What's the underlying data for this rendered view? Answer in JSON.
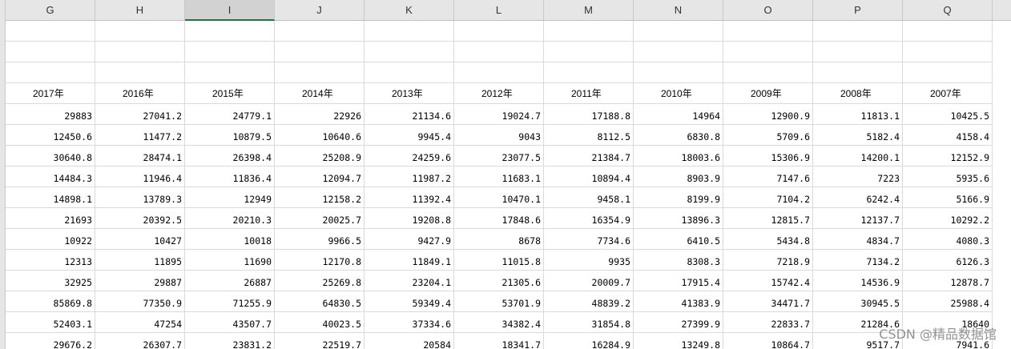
{
  "columns": [
    "G",
    "H",
    "I",
    "J",
    "K",
    "L",
    "M",
    "N",
    "O",
    "P",
    "Q"
  ],
  "active_column": "I",
  "year_headers": [
    "2017年",
    "2016年",
    "2015年",
    "2014年",
    "2013年",
    "2012年",
    "2011年",
    "2010年",
    "2009年",
    "2008年",
    "2007年"
  ],
  "rows": [
    [
      "29883",
      "27041.2",
      "24779.1",
      "22926",
      "21134.6",
      "19024.7",
      "17188.8",
      "14964",
      "12900.9",
      "11813.1",
      "10425.5"
    ],
    [
      "12450.6",
      "11477.2",
      "10879.5",
      "10640.6",
      "9945.4",
      "9043",
      "8112.5",
      "6830.8",
      "5709.6",
      "5182.4",
      "4158.4"
    ],
    [
      "30640.8",
      "28474.1",
      "26398.4",
      "25208.9",
      "24259.6",
      "23077.5",
      "21384.7",
      "18003.6",
      "15306.9",
      "14200.1",
      "12152.9"
    ],
    [
      "14484.3",
      "11946.4",
      "11836.4",
      "12094.7",
      "11987.2",
      "11683.1",
      "10894.4",
      "8903.9",
      "7147.6",
      "7223",
      "5935.6"
    ],
    [
      "14898.1",
      "13789.3",
      "12949",
      "12158.2",
      "11392.4",
      "10470.1",
      "9458.1",
      "8199.9",
      "7104.2",
      "6242.4",
      "5166.9"
    ],
    [
      "21693",
      "20392.5",
      "20210.3",
      "20025.7",
      "19208.8",
      "17848.6",
      "16354.9",
      "13896.3",
      "12815.7",
      "12137.7",
      "10292.2"
    ],
    [
      "10922",
      "10427",
      "10018",
      "9966.5",
      "9427.9",
      "8678",
      "7734.6",
      "6410.5",
      "5434.8",
      "4834.7",
      "4080.3"
    ],
    [
      "12313",
      "11895",
      "11690",
      "12170.8",
      "11849.1",
      "11015.8",
      "9935",
      "8308.3",
      "7218.9",
      "7134.2",
      "6126.3"
    ],
    [
      "32925",
      "29887",
      "26887",
      "25269.8",
      "23204.1",
      "21305.6",
      "20009.7",
      "17915.4",
      "15742.4",
      "14536.9",
      "12878.7"
    ],
    [
      "85869.8",
      "77350.9",
      "71255.9",
      "64830.5",
      "59349.4",
      "53701.9",
      "48839.2",
      "41383.9",
      "34471.7",
      "30945.5",
      "25988.4"
    ],
    [
      "52403.1",
      "47254",
      "43507.7",
      "40023.5",
      "37334.6",
      "34382.4",
      "31854.8",
      "27399.9",
      "22833.7",
      "21284.6",
      "18640"
    ],
    [
      "29676.2",
      "26307.7",
      "23831.2",
      "22519.7",
      "20584",
      "18341.7",
      "16284.9",
      "13249.8",
      "10864.7",
      "9517.7",
      "7941.6"
    ]
  ],
  "watermark": "CSDN @精品数据馆",
  "colors": {
    "header_bg": "#e6e6e6",
    "active_col_bg": "#d2d2d2",
    "active_col_accent": "#217346",
    "grid_line": "#dadada"
  }
}
